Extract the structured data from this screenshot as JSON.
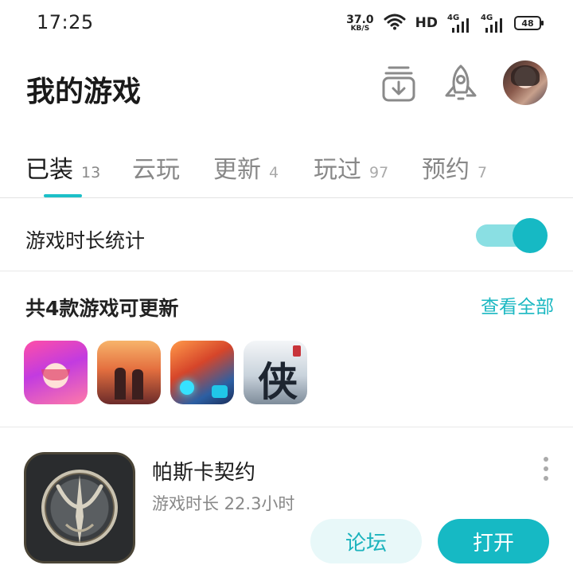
{
  "status_bar": {
    "time": "17:25",
    "net_speed_value": "37.0",
    "net_speed_unit": "KB/S",
    "hd_label": "HD",
    "sim1_label": "4G",
    "sim2_label": "4G",
    "battery": "48"
  },
  "header": {
    "title": "我的游戏"
  },
  "tabs": [
    {
      "label": "已装",
      "count": "13"
    },
    {
      "label": "云玩",
      "count": ""
    },
    {
      "label": "更新",
      "count": "4"
    },
    {
      "label": "玩过",
      "count": "97"
    },
    {
      "label": "预约",
      "count": "7"
    }
  ],
  "stats": {
    "label": "游戏时长统计",
    "enabled": true
  },
  "updates": {
    "title": "共4款游戏可更新",
    "view_all": "查看全部",
    "thumb4_char": "侠"
  },
  "game_card": {
    "name": "帕斯卡契约",
    "playtime": "游戏时长 22.3小时",
    "forum_label": "论坛",
    "open_label": "打开"
  },
  "colors": {
    "accent": "#16b9c4",
    "accent_light": "#8adfe3"
  }
}
